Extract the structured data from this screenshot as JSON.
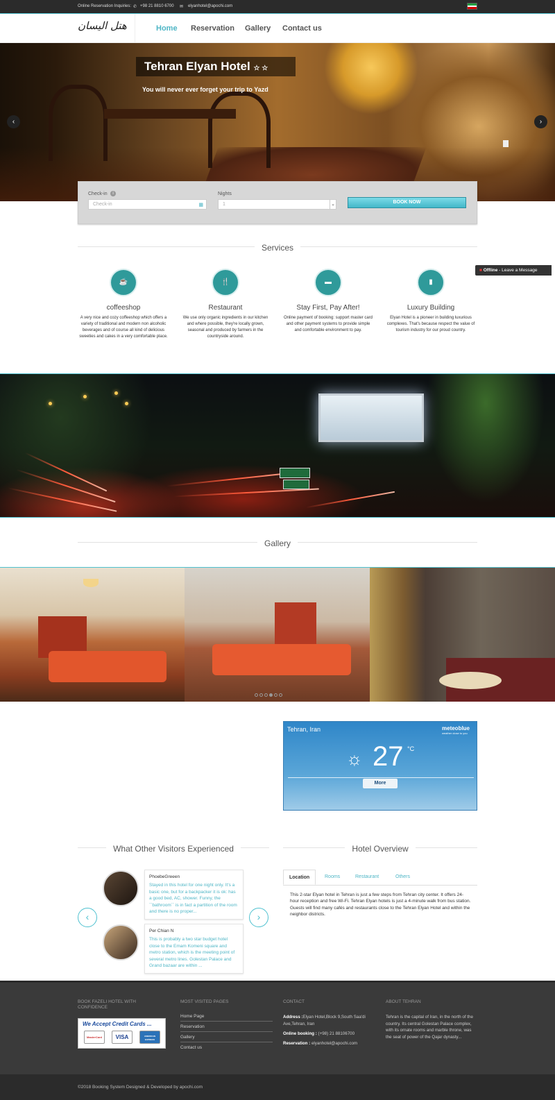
{
  "topbar": {
    "inquiries_label": "Online Reservation Inquiries:",
    "phone": "+98 21 8810 6700",
    "email": "elyanhotel@apochi.com"
  },
  "header": {
    "logo_text": "هتل الیسان",
    "nav": [
      "Home",
      "Reservation",
      "Gallery",
      "Contact us"
    ],
    "active_nav": "Home",
    "accent_color": "#4fc1d0"
  },
  "hero": {
    "title": "Tehran Elyan Hotel",
    "stars": "☆ ☆",
    "subtitle": "You will never ever forget your trip to Yazd",
    "prev_icon": "chevron-left-icon",
    "next_icon": "chevron-right-icon"
  },
  "booking": {
    "checkin_label": "Check-in",
    "checkin_placeholder": "Check-in",
    "nights_label": "Nights",
    "nights_value": "1",
    "book_button": "BOOK NOW"
  },
  "services": {
    "title": "Services",
    "items": [
      {
        "icon": "coffee-icon",
        "title": "coffeeshop",
        "text": "A very nice and cozy coffeeshop which offers a variety of traditional and modern non alcoholic beverages and of course all kind of delicious sweeties and cakes in a very comfortable place."
      },
      {
        "icon": "utensils-icon",
        "title": "Restaurant",
        "text": "We use only organic ingredients in our kitchen and where possible, they're locally grown, seasonal and produced by farmers in the countryside around."
      },
      {
        "icon": "credit-card-icon",
        "title": "Stay First, Pay After!",
        "text": "Online payment of booking: support master card and other payment systems to provide simple and comfortable environment to pay."
      },
      {
        "icon": "building-icon",
        "title": "Luxury Building",
        "text": "Elyan Hotel is a pioneer in building luxurious complexes. That's because respect the value of tourism industry for our proud country."
      }
    ]
  },
  "chat": {
    "status": "Offline",
    "action": "Leave a Message"
  },
  "gallery": {
    "title": "Gallery"
  },
  "weather": {
    "location": "Tehran, Iran",
    "brand": "meteoblue",
    "brand_tagline": "weather  close to you",
    "temperature": "27",
    "unit": "°C",
    "icon": "partly-cloudy-icon",
    "more_button": "More"
  },
  "testimonials": {
    "title": "What Other Visitors Experienced",
    "items": [
      {
        "name": "PhoebeGreeen",
        "text": "Stayed in this hotel for one night only. It's a basic one, but for a backpacker it is ok: has a good bed, AC, shower. Funny, the ``bathroom`` is in fact a partition of the room and there is no proper..."
      },
      {
        "name": "Per Chian N",
        "text": "This is probably a two star budget hotel close to the Emam Komeni square and metro station, which is the meeting point of several metro lines. Golestan Palace and Grand bazaar are within ..."
      }
    ]
  },
  "overview": {
    "title": "Hotel Overview",
    "tabs": [
      "Location",
      "Rooms",
      "Restaurant",
      "Others"
    ],
    "active_tab": "Location",
    "text": "This 2-star Elyan hotel in Tehran is just a few steps from Tehran city center. It offers 24-hour reception and free Wi-Fi. Tehran Elyan hotels is just a 4-minute walk from bus station. Guests will find many cafés and restaurants close to the Tehran Elyan Hotel and within the neighbor districts."
  },
  "footer": {
    "col1_title": "BOOK FAZELI HOTEL WITH CONFIDENCE",
    "cards_heading": "We Accept Credit Cards ...",
    "cards": [
      "MasterCard",
      "VISA",
      "AMERICAN EXPRESS"
    ],
    "col2_title": "MOST VISITED PAGES",
    "links": [
      "Home Page",
      "Reservation",
      "Gallery",
      "Contact us"
    ],
    "col3_title": "CONTACT",
    "address_label": "Address :",
    "address": "Elyan Hotel,Block 9,South Saa'di Ave,Tehran, Iran",
    "booking_label": "Online booking :",
    "booking_phone": "(+98) 21 88106700",
    "reservation_label": "Reservation :",
    "reservation_email": "elyanhotel@apochi.com",
    "col4_title": "ABOUT TEHRAN",
    "about": "Tehran is the capital of Iran, in the north of the country. Its central Golestan Palace complex, with its ornate rooms and marble throne, was the seat of power of the Qajar dynasty...",
    "copyright": "©2018 Booking System Designed & Developed by apochi.com"
  }
}
